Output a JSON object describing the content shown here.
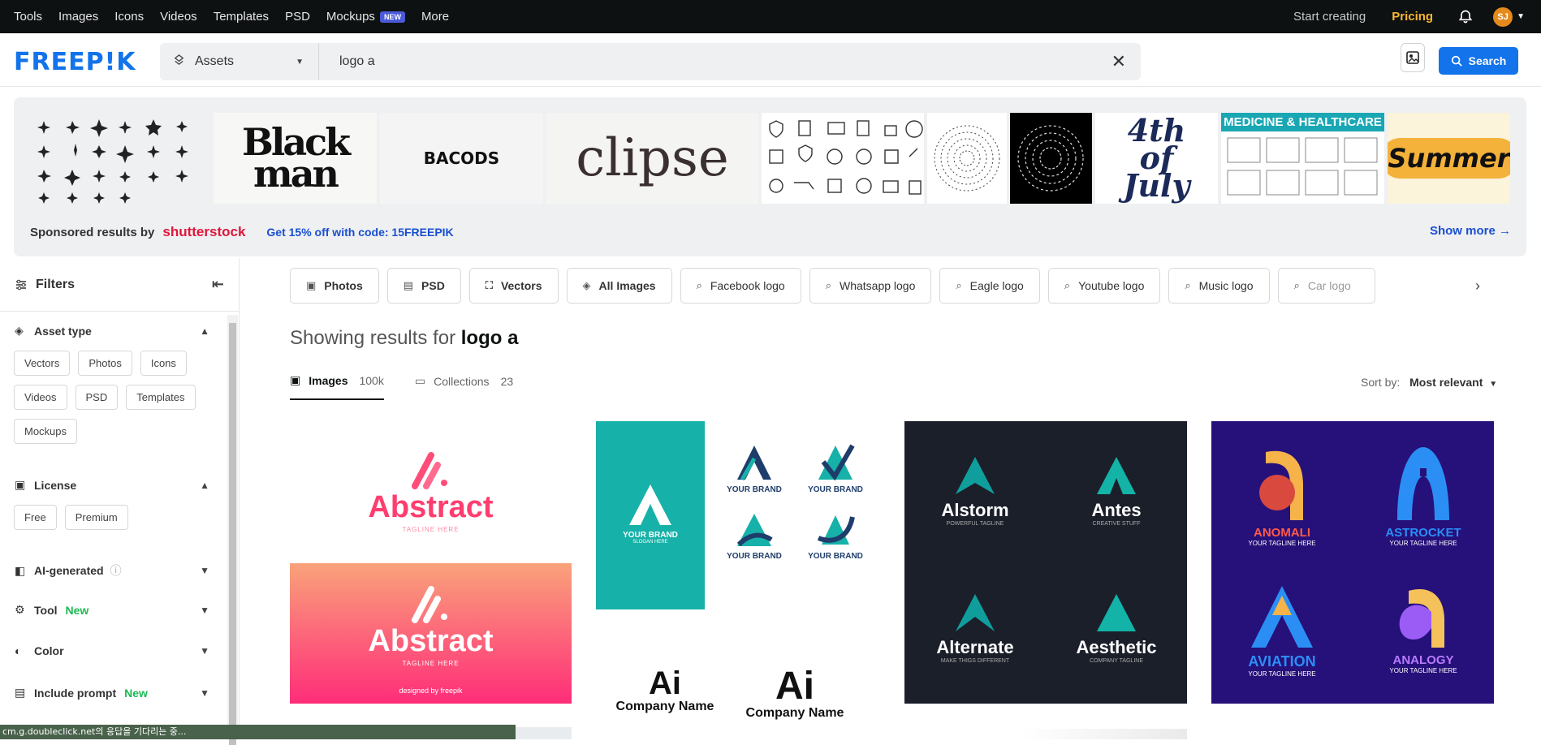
{
  "topbar": {
    "nav": [
      "Tools",
      "Images",
      "Icons",
      "Videos",
      "Templates",
      "PSD",
      "Mockups",
      "More"
    ],
    "mockups_badge": "NEW",
    "start_creating": "Start creating",
    "pricing": "Pricing",
    "avatar_initials": "SJ"
  },
  "header": {
    "logo": "FREEP!K",
    "asset_selector": "Assets",
    "query": "logo a"
  },
  "search_button": "Search",
  "sponsored": {
    "label": "Sponsored results by",
    "brand": "shutterstock",
    "promo": "Get 15% off with code: 15FREEPIK",
    "show_more": "Show more",
    "thumb_texts": [
      "Black man",
      "BACODS",
      "clipse",
      "MEDICINE & HEALTHCARE",
      "Summer",
      "4th of July"
    ]
  },
  "filters": {
    "title": "Filters",
    "sections": {
      "asset_type": {
        "title": "Asset type",
        "chips": [
          "Vectors",
          "Photos",
          "Icons",
          "Videos",
          "PSD",
          "Templates",
          "Mockups"
        ]
      },
      "license": {
        "title": "License",
        "chips": [
          "Free",
          "Premium"
        ]
      },
      "ai_generated": {
        "title": "AI-generated"
      },
      "tool": {
        "title": "Tool",
        "badge": "New"
      },
      "color": {
        "title": "Color"
      },
      "include_prompt": {
        "title": "Include prompt",
        "badge": "New"
      }
    }
  },
  "tags": [
    "Photos",
    "PSD",
    "Vectors",
    "All Images",
    "Facebook logo",
    "Whatsapp logo",
    "Eagle logo",
    "Youtube logo",
    "Music logo",
    "Car logo"
  ],
  "results": {
    "prefix": "Showing results for",
    "query": "logo a",
    "tabs": [
      {
        "label": "Images",
        "count": "100k"
      },
      {
        "label": "Collections",
        "count": "23"
      }
    ],
    "sort_label": "Sort by:",
    "sort_value": "Most relevant"
  },
  "cards": {
    "abstract1": {
      "title": "Abstract",
      "tagline": "TAGLINE HERE"
    },
    "abstract2": {
      "title": "Abstract",
      "tagline": "TAGLINE HERE",
      "credit": "designed by freepik"
    },
    "brand": {
      "label": "YOUR BRAND",
      "slogan": "SLOGAN HERE"
    },
    "dark": [
      {
        "name": "Alstorm",
        "tag": "POWERFUL TAGLINE"
      },
      {
        "name": "Antes",
        "tag": "CREATIVE STUFF"
      },
      {
        "name": "Alternate",
        "tag": "MAKE THIGS DIFFERENT"
      },
      {
        "name": "Aesthetic",
        "tag": "COMPANY TAGLINE"
      }
    ],
    "purple": [
      {
        "name": "ANOMALI",
        "tag": "YOUR TAGLINE HERE"
      },
      {
        "name": "ASTROCKET",
        "tag": "YOUR TAGLINE HERE"
      },
      {
        "name": "AVIATION",
        "tag": "YOUR TAGLINE HERE"
      },
      {
        "name": "ANALOGY",
        "tag": "YOUR TAGLINE HERE"
      }
    ],
    "company": "Company Name"
  },
  "status_bar": "cm.g.doubleclick.net의 응답을 기다리는 중..."
}
